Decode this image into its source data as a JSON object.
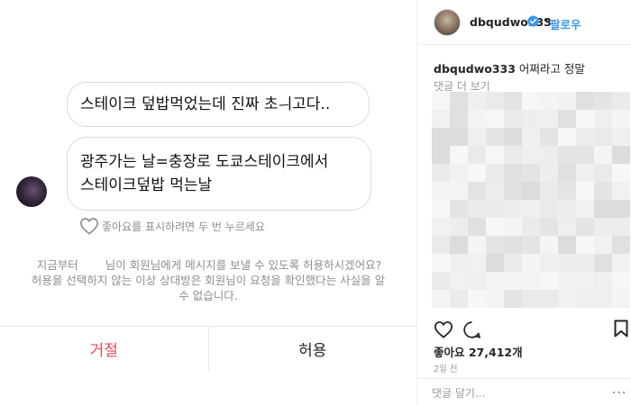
{
  "dm": {
    "messages": [
      {
        "text": "스테이크 덮밥먹었는데 진짜 초ㅢ고다.."
      },
      {
        "line1": "광주가는 날=충장로 도쿄스테이크에서",
        "line2": "스테이크덮밥 먹는날"
      }
    ],
    "like_hint": "좋아요를 표시하려면 두 번 누르세요",
    "request_prefix": "지금부터",
    "request_line1_rest": "님이 회원님에게 메시지를 보낼 수 있도록 허용하시겠어요?",
    "request_line2": "허용을 선택하지 않는 이상 상대방은 회원님이 요청을 확인했다는 사실을 알",
    "request_line3": "수 없습니다.",
    "decline_label": "거절",
    "allow_label": "허용",
    "decline_color": "#ed4956"
  },
  "post": {
    "username": "dbqudwo333",
    "follow_label": "팔로우",
    "dot": "•",
    "caption_user": "dbqudwo333",
    "caption_text": "어쩌라고 정말",
    "more_comments": "댓글 더 보기",
    "likes": "좋아요 27,412개",
    "time": "2일 전",
    "comment_placeholder": "댓글 달기...",
    "more_options": "···",
    "link_color": "#3897f0",
    "icons": [
      "verified-icon",
      "heart-icon",
      "comment-icon",
      "bookmark-icon",
      "more-options-icon"
    ]
  }
}
